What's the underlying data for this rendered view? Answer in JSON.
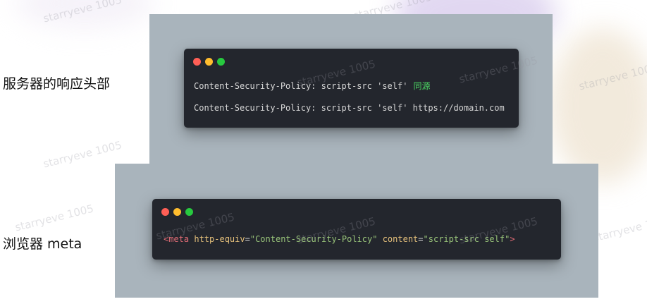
{
  "sections": [
    {
      "label": "服务器的响应头部",
      "terminal": {
        "lines": [
          {
            "code": "Content-Security-Policy: script-src 'self'",
            "note": "同源"
          },
          {
            "code": "Content-Security-Policy: script-src 'self' https://domain.com",
            "note": ""
          }
        ]
      }
    },
    {
      "label": "浏览器 meta",
      "terminal": {
        "tokens": [
          {
            "text": "<meta",
            "kind": "tag"
          },
          {
            "text": " ",
            "kind": "plain"
          },
          {
            "text": "http-equiv",
            "kind": "attr"
          },
          {
            "text": "=",
            "kind": "plain"
          },
          {
            "text": "\"Content-Security-Policy\"",
            "kind": "str"
          },
          {
            "text": " ",
            "kind": "plain"
          },
          {
            "text": "content",
            "kind": "attr"
          },
          {
            "text": "=",
            "kind": "plain"
          },
          {
            "text": "\"script-src self\"",
            "kind": "str"
          },
          {
            "text": ">",
            "kind": "tag"
          }
        ]
      }
    }
  ],
  "window_dots": {
    "red": "#ff5f56",
    "yellow": "#ffbd2e",
    "green": "#27c93f"
  },
  "colors": {
    "panel": "#a9b4bc",
    "terminal": "#23262d",
    "note": "#4cd964"
  },
  "watermark": "starryeve 1005"
}
